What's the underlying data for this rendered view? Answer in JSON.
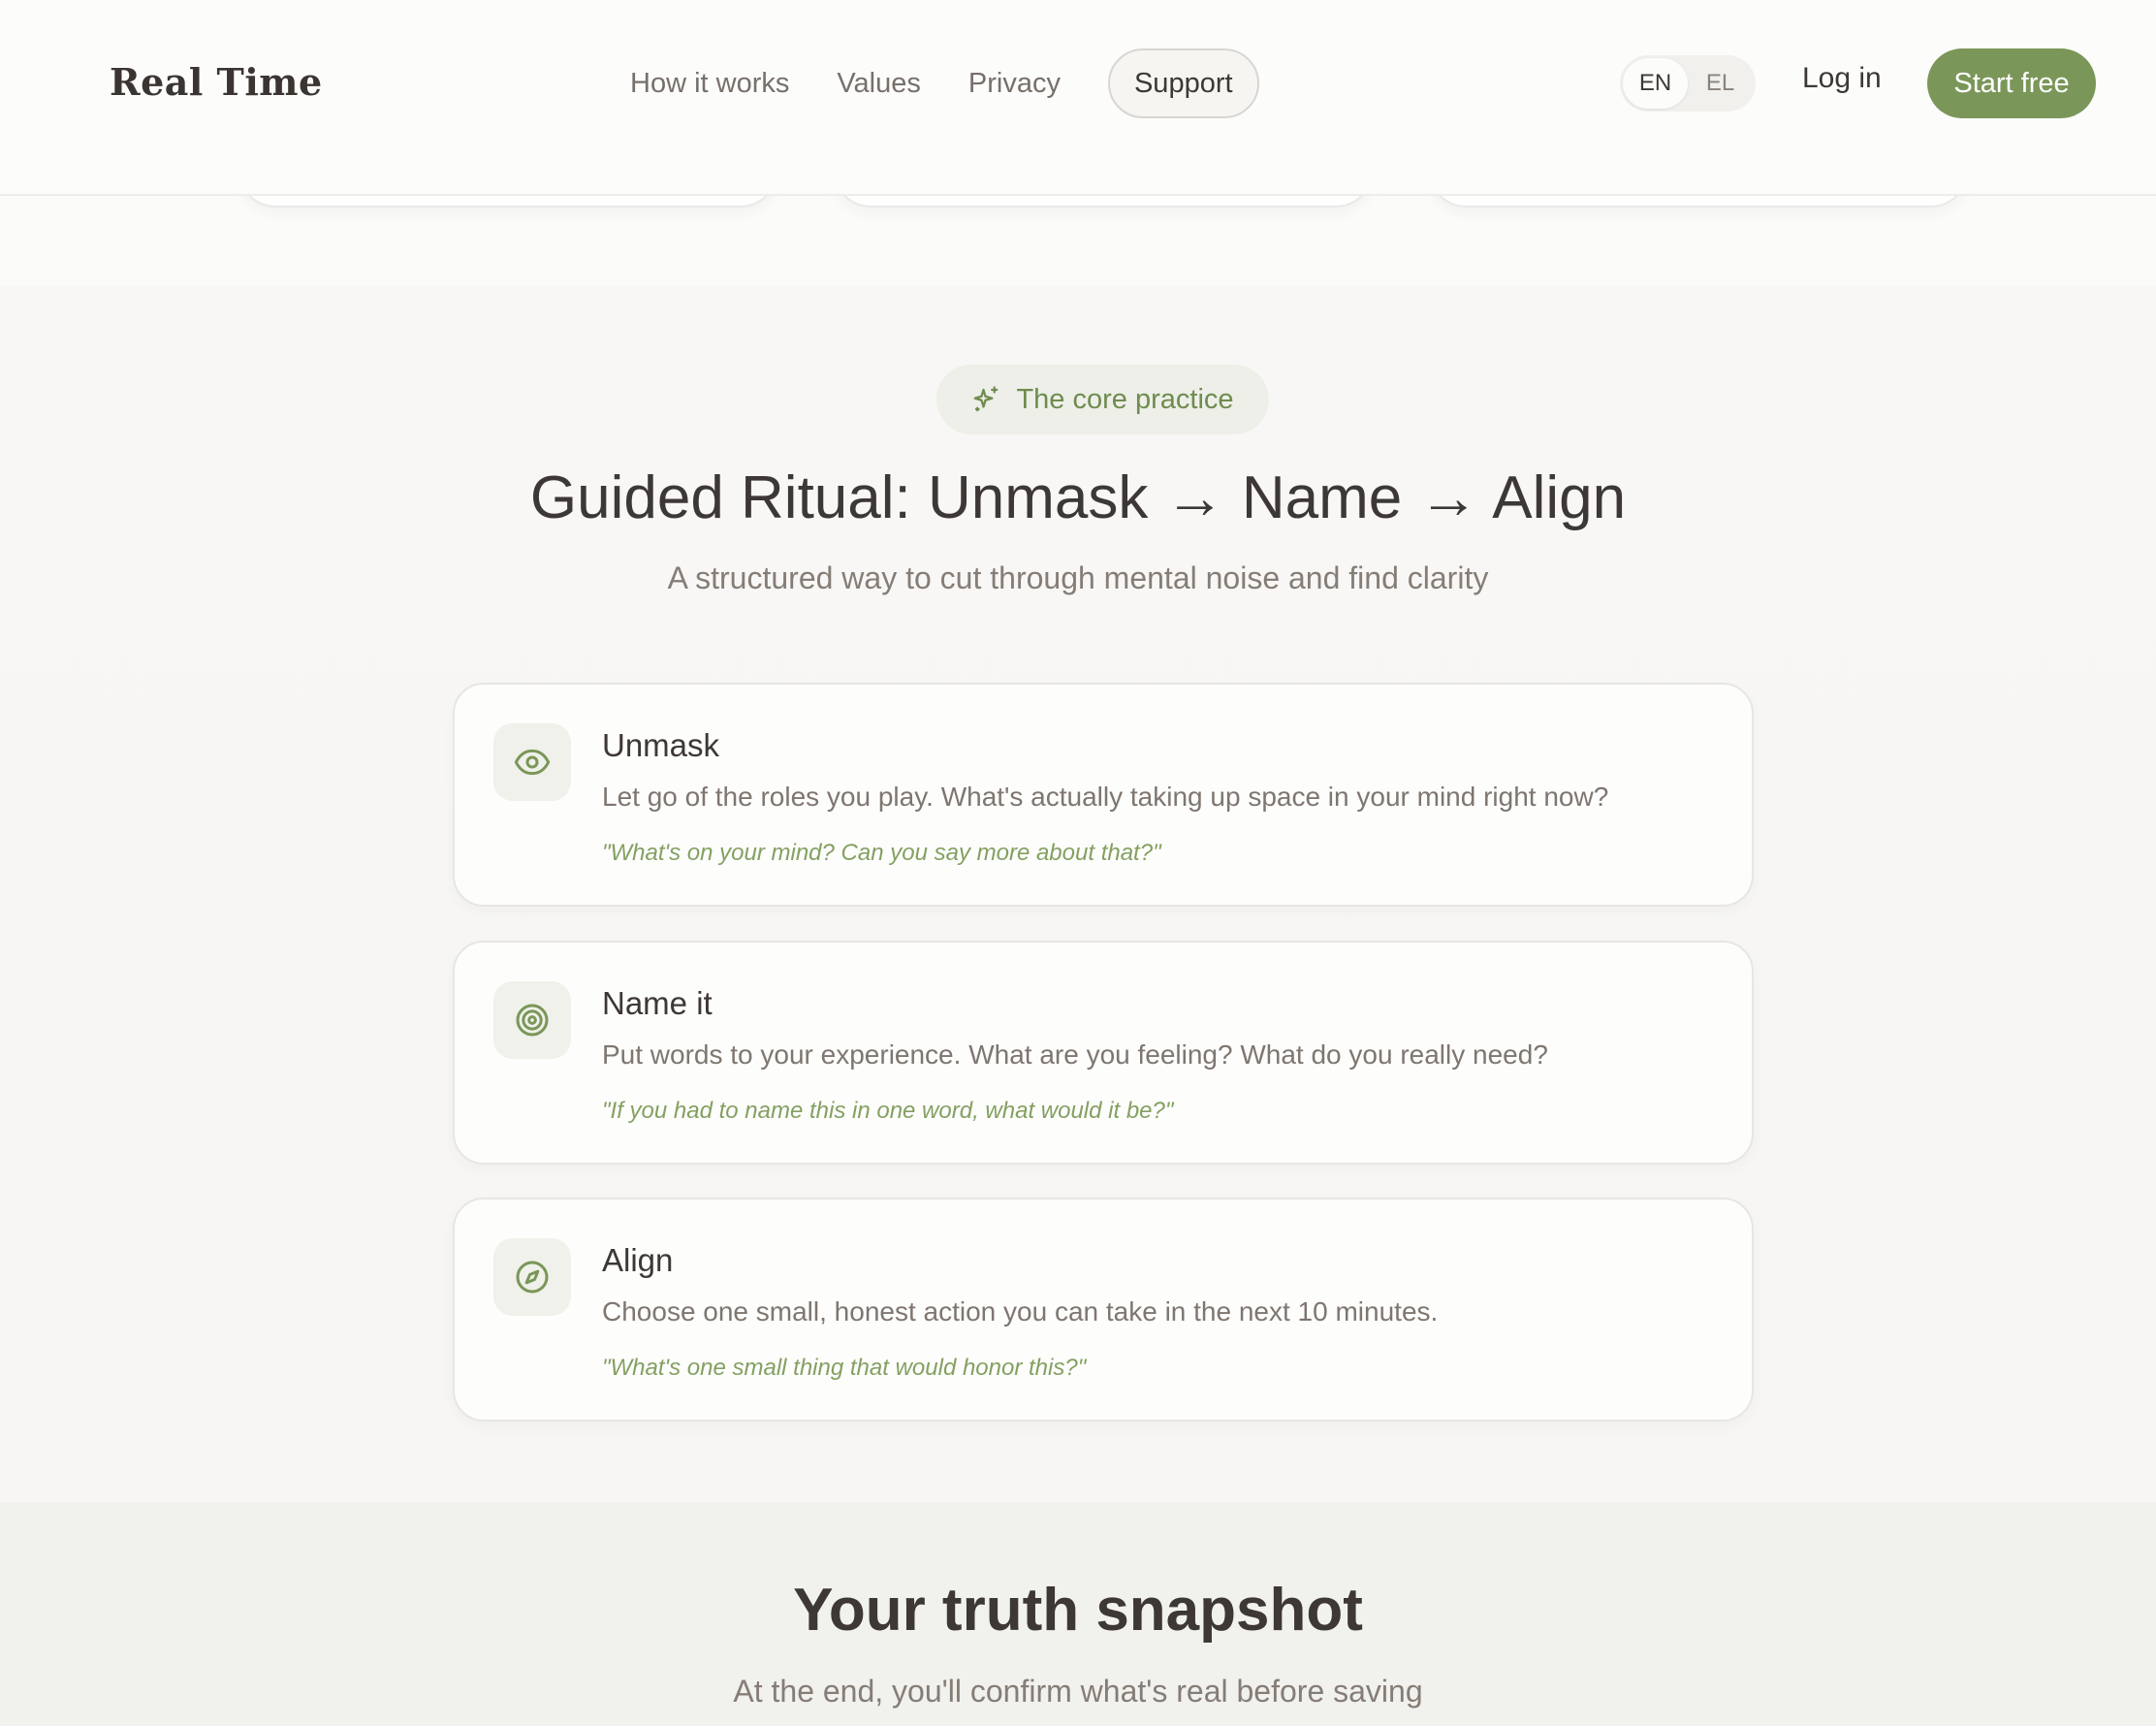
{
  "header": {
    "brand": "Real Time",
    "nav": [
      "How it works",
      "Values",
      "Privacy"
    ],
    "support_label": "Support",
    "lang": [
      "EN",
      "EL"
    ],
    "lang_active": "EN",
    "login_label": "Log in",
    "start_label": "Start free"
  },
  "core": {
    "badge_icon": "sparkle-icon",
    "badge_label": "The core practice",
    "title": "Guided Ritual: Unmask → Name → Align",
    "subtitle": "A structured way to cut through mental noise and find clarity",
    "steps": [
      {
        "icon": "eye-icon",
        "title": "Unmask",
        "description": "Let go of the roles you play. What's actually taking up space in your mind right now?",
        "prompt": "\"What's on your mind? Can you say more about that?\""
      },
      {
        "icon": "target-icon",
        "title": "Name it",
        "description": "Put words to your experience. What are you feeling? What do you really need?",
        "prompt": "\"If you had to name this in one word, what would it be?\""
      },
      {
        "icon": "compass-icon",
        "title": "Align",
        "description": "Choose one small, honest action you can take in the next 10 minutes.",
        "prompt": "\"What's one small thing that would honor this?\""
      }
    ]
  },
  "snapshot": {
    "title": "Your truth snapshot",
    "subtitle": "At the end, you'll confirm what's real before saving"
  },
  "colors": {
    "accent": "#7b9659",
    "accent_text": "#6f8c4f",
    "badge_bg": "#edefe8",
    "text": "#3d3835",
    "muted": "#857d76"
  }
}
